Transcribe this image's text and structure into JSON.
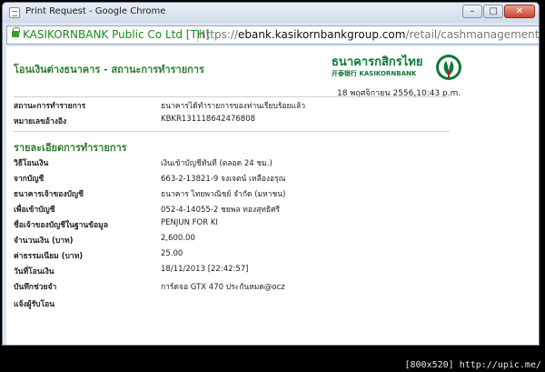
{
  "window": {
    "title": "Print Request - Google Chrome",
    "buttons": {
      "minimize": "–",
      "maximize": "□",
      "close": "✕"
    }
  },
  "urlbar": {
    "ssl_name": "KASIKORNBANK Public Co Ltd [TH]",
    "scheme": "https://",
    "host": "ebank.kasikornbankgroup.com",
    "path": "/retail/cashmanagement/FundTrans"
  },
  "header": {
    "title": "โอนเงินต่างธนาคาร - สถานะการทำรายการ",
    "logo_th": "ธนาคารกสิกรไทย",
    "logo_en": "开泰银行 KASIKORNBANK",
    "datetime": "18 พฤศจิกายน 2556,10:43 p.m."
  },
  "status": [
    {
      "label": "สถานะการทำรายการ",
      "value": "ธนาคารได้ทำรายการของท่านเรียบร้อยแล้ว"
    },
    {
      "label": "หมายเลขอ้างอิง",
      "value": "KBKR131118642476808"
    }
  ],
  "details": {
    "title": "รายละเอียดการทำรายการ",
    "rows": [
      {
        "label": "วิธีโอนเงิน",
        "value": "เงินเข้าบัญชีทันที (ตลอด 24 ชม.)"
      },
      {
        "label": "จากบัญชี",
        "value": "663-2-13821-9 จงเจตน์ เหลืองอรุณ"
      },
      {
        "label": "ธนาคารเจ้าของบัญชี",
        "value": "ธนาคาร ไทยพาณิชย์ จำกัด (มหาชน)"
      },
      {
        "label": "เพื่อเข้าบัญชี",
        "value": "052-4-14055-2 ชยพล ทองสุทธิศรี"
      },
      {
        "label": "ชื่อเจ้าของบัญชีในฐานข้อมูล",
        "value": "PENJUN FOR KI"
      },
      {
        "label": "จำนวนเงิน (บาท)",
        "value": "2,600.00"
      },
      {
        "label": "ค่าธรรมเนียม (บาท)",
        "value": "25.00"
      },
      {
        "label": "วันที่โอนเงิน",
        "value": "18/11/2013 [22:42:57]"
      },
      {
        "label": "บันทึกช่วยจำ",
        "value": "การ์ดจอ GTX 470 ประกันหมด@ocz"
      },
      {
        "label": "แจ้งผู้รับโอน",
        "value": ""
      }
    ]
  },
  "watermark": "[800x520] http://upic.me/",
  "colors": {
    "heading_green": "#2e7d2e",
    "brand_green": "#0b7a35",
    "ssl_green": "#1e8a1e"
  }
}
